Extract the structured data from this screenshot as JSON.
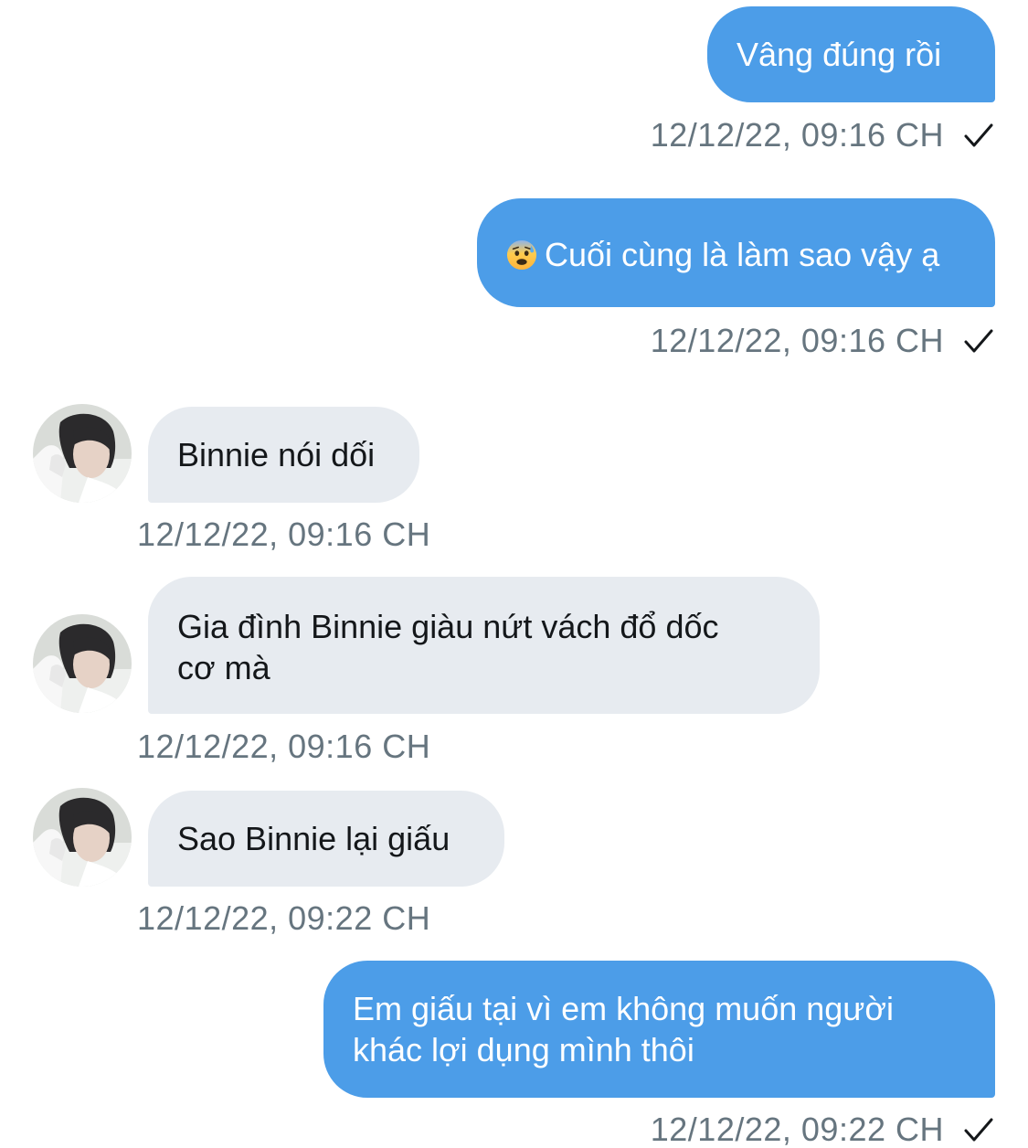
{
  "conversation": {
    "messages": [
      {
        "direction": "sent",
        "text": "Vâng đúng rồi",
        "time": "12/12/22, 09:16 CH",
        "status": "sent"
      },
      {
        "direction": "sent",
        "emoji": "anxious-face-with-sweat",
        "text": "Cuối cùng là làm sao vậy ạ",
        "time": "12/12/22, 09:16 CH",
        "status": "sent"
      },
      {
        "direction": "received",
        "text": "Binnie nói dối",
        "time": "12/12/22, 09:16 CH"
      },
      {
        "direction": "received",
        "lines": [
          "Gia đình Binnie giàu nứt vách đổ dốc",
          "cơ mà"
        ],
        "time": "12/12/22, 09:16 CH"
      },
      {
        "direction": "received",
        "text": "Sao Binnie lại giấu",
        "time": "12/12/22, 09:22 CH"
      },
      {
        "direction": "sent",
        "lines": [
          "Em giấu tại vì em không muốn người",
          "khác lợi dụng mình thôi"
        ],
        "time": "12/12/22, 09:22 CH",
        "status": "sent"
      }
    ]
  },
  "colors": {
    "sent_bubble": "#4c9de8",
    "received_bubble": "#e7ebf0",
    "timestamp": "#66757f",
    "background": "#ffffff"
  },
  "icons": {
    "read_receipt": "check-icon",
    "avatar": "avatar",
    "emoji": "anxious-face-with-sweat-emoji"
  }
}
